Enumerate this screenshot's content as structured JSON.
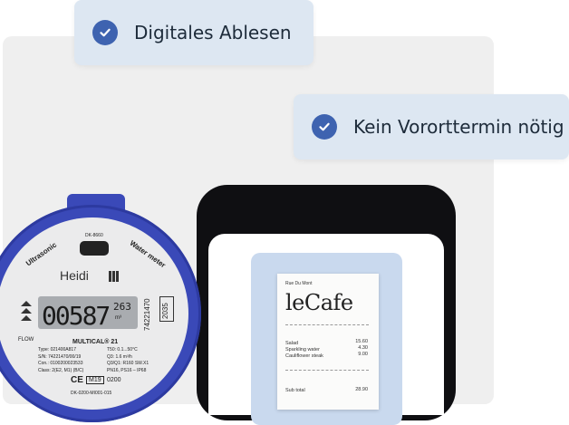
{
  "badges": [
    {
      "label": "Digitales Ablesen",
      "icon": "check-circle-icon"
    },
    {
      "label": "Kein Vororttermin nötig",
      "icon": "check-circle-icon"
    }
  ],
  "receipt": {
    "street": "Rue Du Mont",
    "brand": "leCafe",
    "items": [
      {
        "name": "Salad",
        "price": "15.60"
      },
      {
        "name": "Sparkling water",
        "price": "4.30"
      },
      {
        "name": "Cauliflower steak",
        "price": "9.00"
      }
    ],
    "subtotal_label": "Sub total",
    "subtotal_value": "28.90"
  },
  "meter": {
    "top_code": "DK-8660",
    "arc_left": "Ultrasonic",
    "arc_right": "Water meter",
    "brand": "Heidi",
    "reading": "00587",
    "reading_decimals": "263",
    "unit": "m³",
    "serial_vertical": "74221470",
    "box_number": "2035",
    "flow_label": "FLOW",
    "model": "MULTICAL® 21",
    "specs_left": [
      "Type: 021400A817",
      "S/N: 74221470/00/19",
      "Con.: 0100200023533",
      "Class: 2(E2, M1) (B/C)"
    ],
    "specs_right": [
      "T50: 0.1...50°C",
      "Q3: 1.6 m³/h",
      "Q3/Q1: R160  SW.X1",
      "PN16, PS16 – IP68"
    ],
    "ce": "CE",
    "m19": "M19",
    "m19_number": "0200",
    "bottom_code": "DK-0200-MI001-015"
  },
  "colors": {
    "accent": "#3e63b0",
    "badge_bg": "#dde7f2",
    "meter_ring": "#3a49b8"
  }
}
